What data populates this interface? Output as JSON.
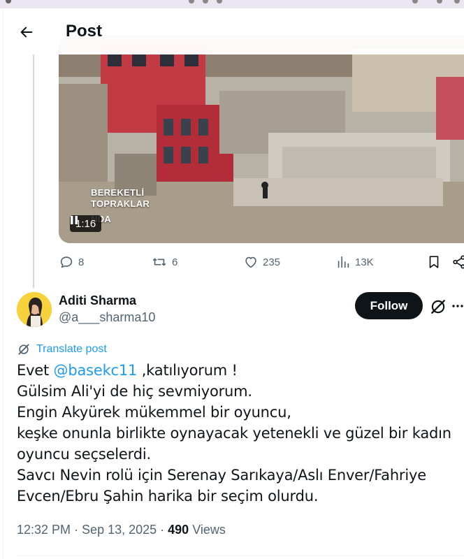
{
  "header": {
    "title": "Post"
  },
  "colors": {
    "accent": "#1d9bf0",
    "text": "#0f1419",
    "muted": "#536471",
    "follow_bg": "#0f1419"
  },
  "media": {
    "overlay_line1": "BEREKETLİ",
    "overlay_line2": "TOPRAKLAR",
    "overlay_line3": "NDA",
    "video_time": "1:16",
    "video_state": "pause-icon"
  },
  "actions": {
    "replies": "8",
    "reposts": "6",
    "likes": "235",
    "views": "13K"
  },
  "author": {
    "display_name": "Aditi Sharma",
    "handle": "@a___sharma10",
    "follow_label": "Follow"
  },
  "translate_label": "Translate post",
  "tweet": {
    "line1_prefix": "Evet ",
    "line1_mention": "@basekc11",
    "line1_suffix": " ,katılıyorum !",
    "lines": [
      "Gülsim Ali'yi de hiç sevmiyorum.",
      "Engin Akyürek mükemmel bir oyuncu,",
      "keşke onunla birlikte oynayacak yetenekli ve güzel bir kadın",
      "oyuncu seçselerdi.",
      "Savcı Nevin rolü için Serenay Sarıkaya/Aslı Enver/Fahriye",
      "Evcen/Ebru Şahin harika bir seçim olurdu."
    ]
  },
  "meta": {
    "time": "12:32 PM",
    "separator": " · ",
    "date": "Sep 13, 2025",
    "views_count": "490",
    "views_label": " Views"
  }
}
